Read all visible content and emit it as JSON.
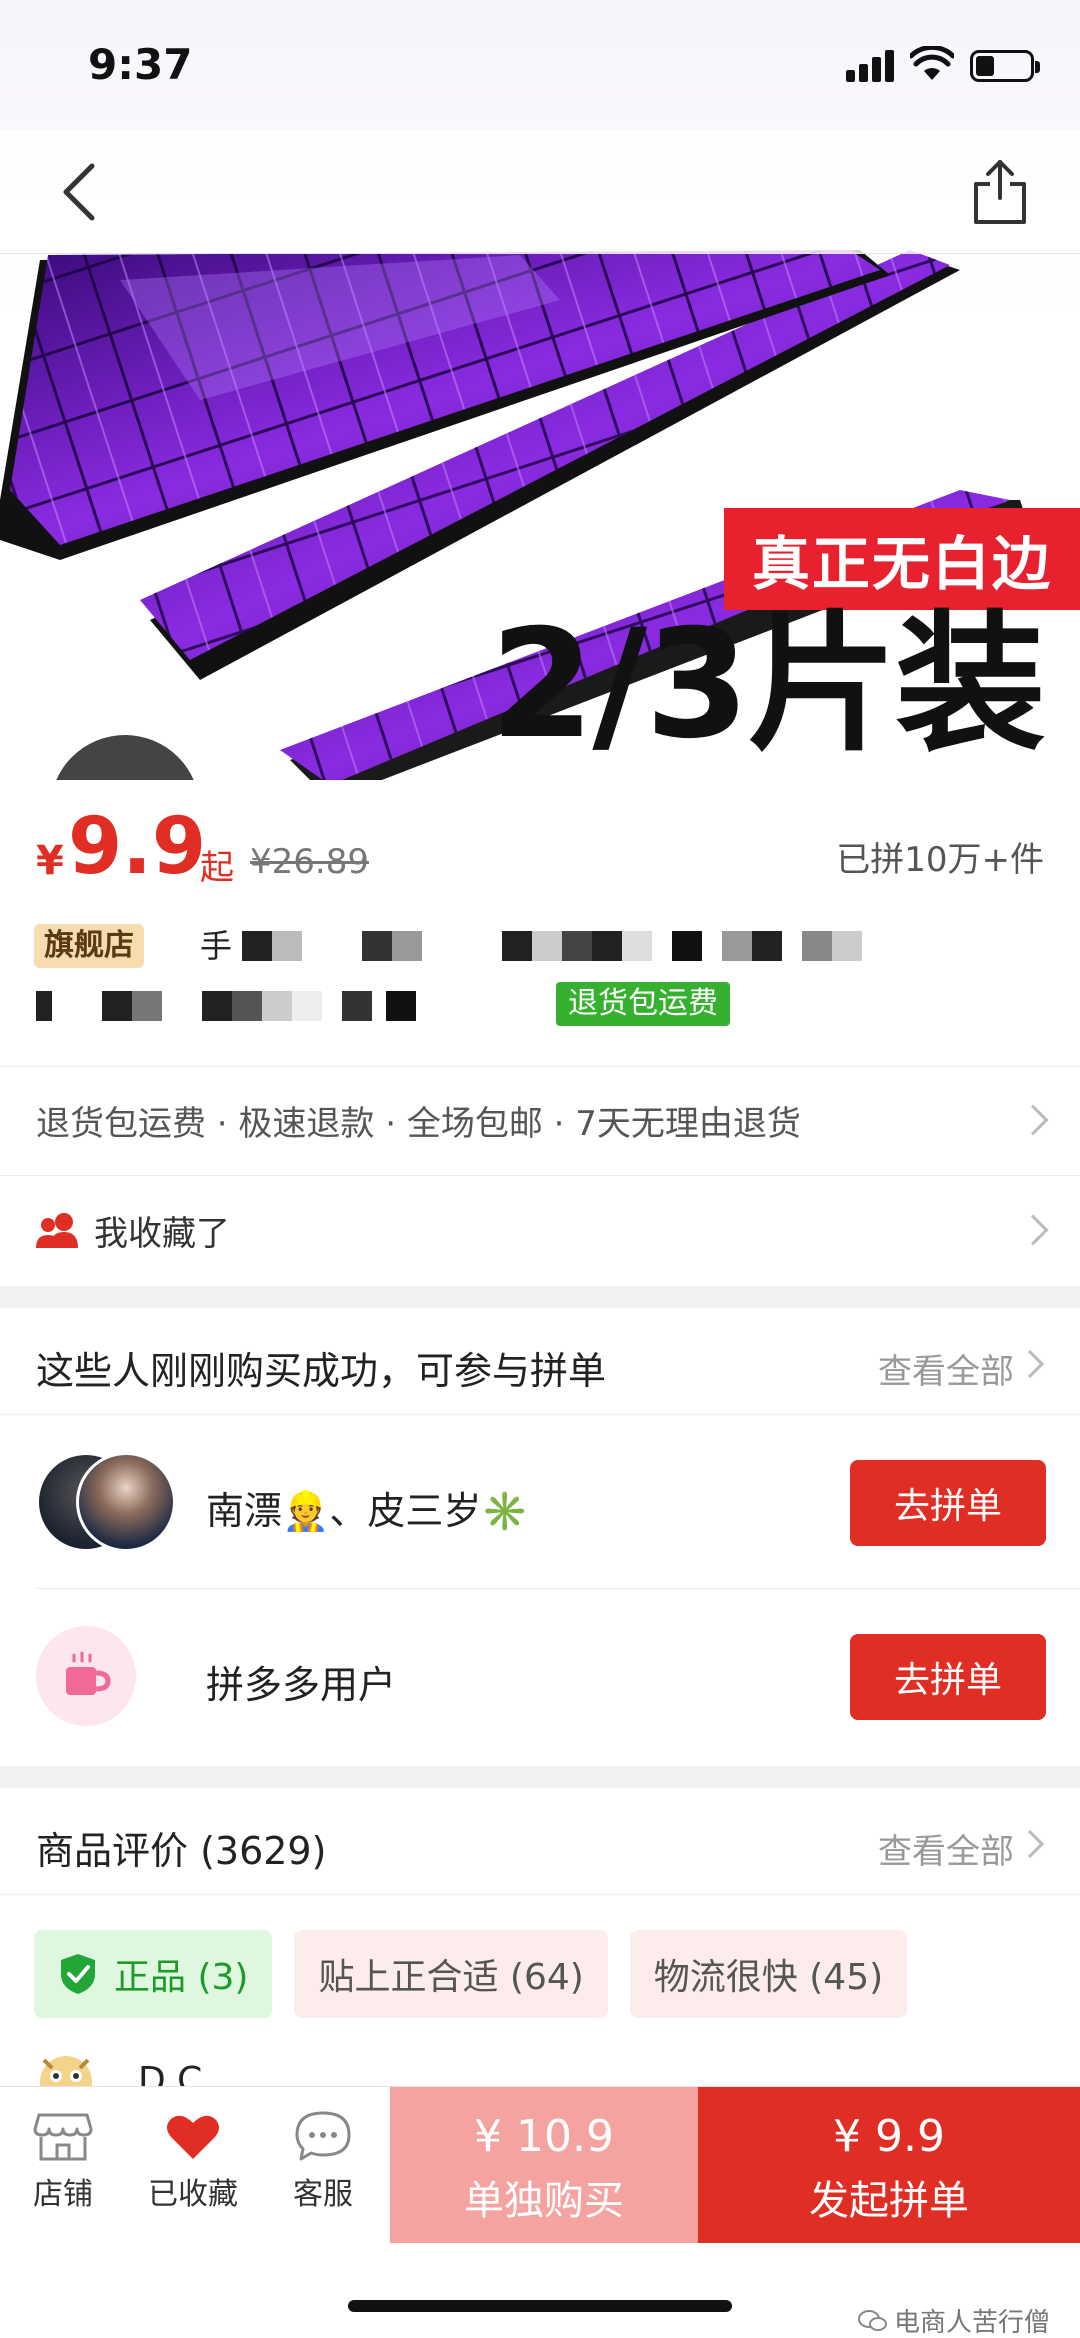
{
  "status_bar": {
    "time": "9:37"
  },
  "hero": {
    "banner": "真正无白边",
    "big_text": "2/3片装"
  },
  "price": {
    "currency": "¥",
    "current": "9.9",
    "suffix": "起",
    "original": "¥26.89",
    "sold": "已拼10万+件"
  },
  "product": {
    "flagship_badge": "旗舰店",
    "title_visible_char": "手",
    "green_tag": "退货包运费"
  },
  "services": {
    "text": "退货包运费 · 极速退款 · 全场包邮 · 7天无理由退货"
  },
  "favorite": {
    "text": "我收藏了"
  },
  "group_buy": {
    "title": "这些人刚刚购买成功，可参与拼单",
    "see_all": "查看全部",
    "rows": [
      {
        "name": "南漂👷、皮三岁✳️",
        "button": "去拼单"
      },
      {
        "name": "拼多多用户",
        "button": "去拼单"
      }
    ]
  },
  "reviews": {
    "title": "商品评价 (3629)",
    "see_all": "查看全部",
    "tags": [
      {
        "label": "正品 (3)",
        "type": "good"
      },
      {
        "label": "贴上正合适 (64)",
        "type": "pink"
      },
      {
        "label": "物流很快 (45)",
        "type": "pink"
      }
    ],
    "first_reviewer": "D.C"
  },
  "bottom_bar": {
    "shop": "店铺",
    "favorited": "已收藏",
    "service": "客服",
    "solo_price": "¥ 10.9",
    "solo_label": "单独购买",
    "group_price": "¥ 9.9",
    "group_label": "发起拼单"
  },
  "watermark": "电商人苦行僧",
  "colors": {
    "accent": "#e02e24",
    "solo": "#f5a3a0",
    "green": "#35b02f"
  }
}
